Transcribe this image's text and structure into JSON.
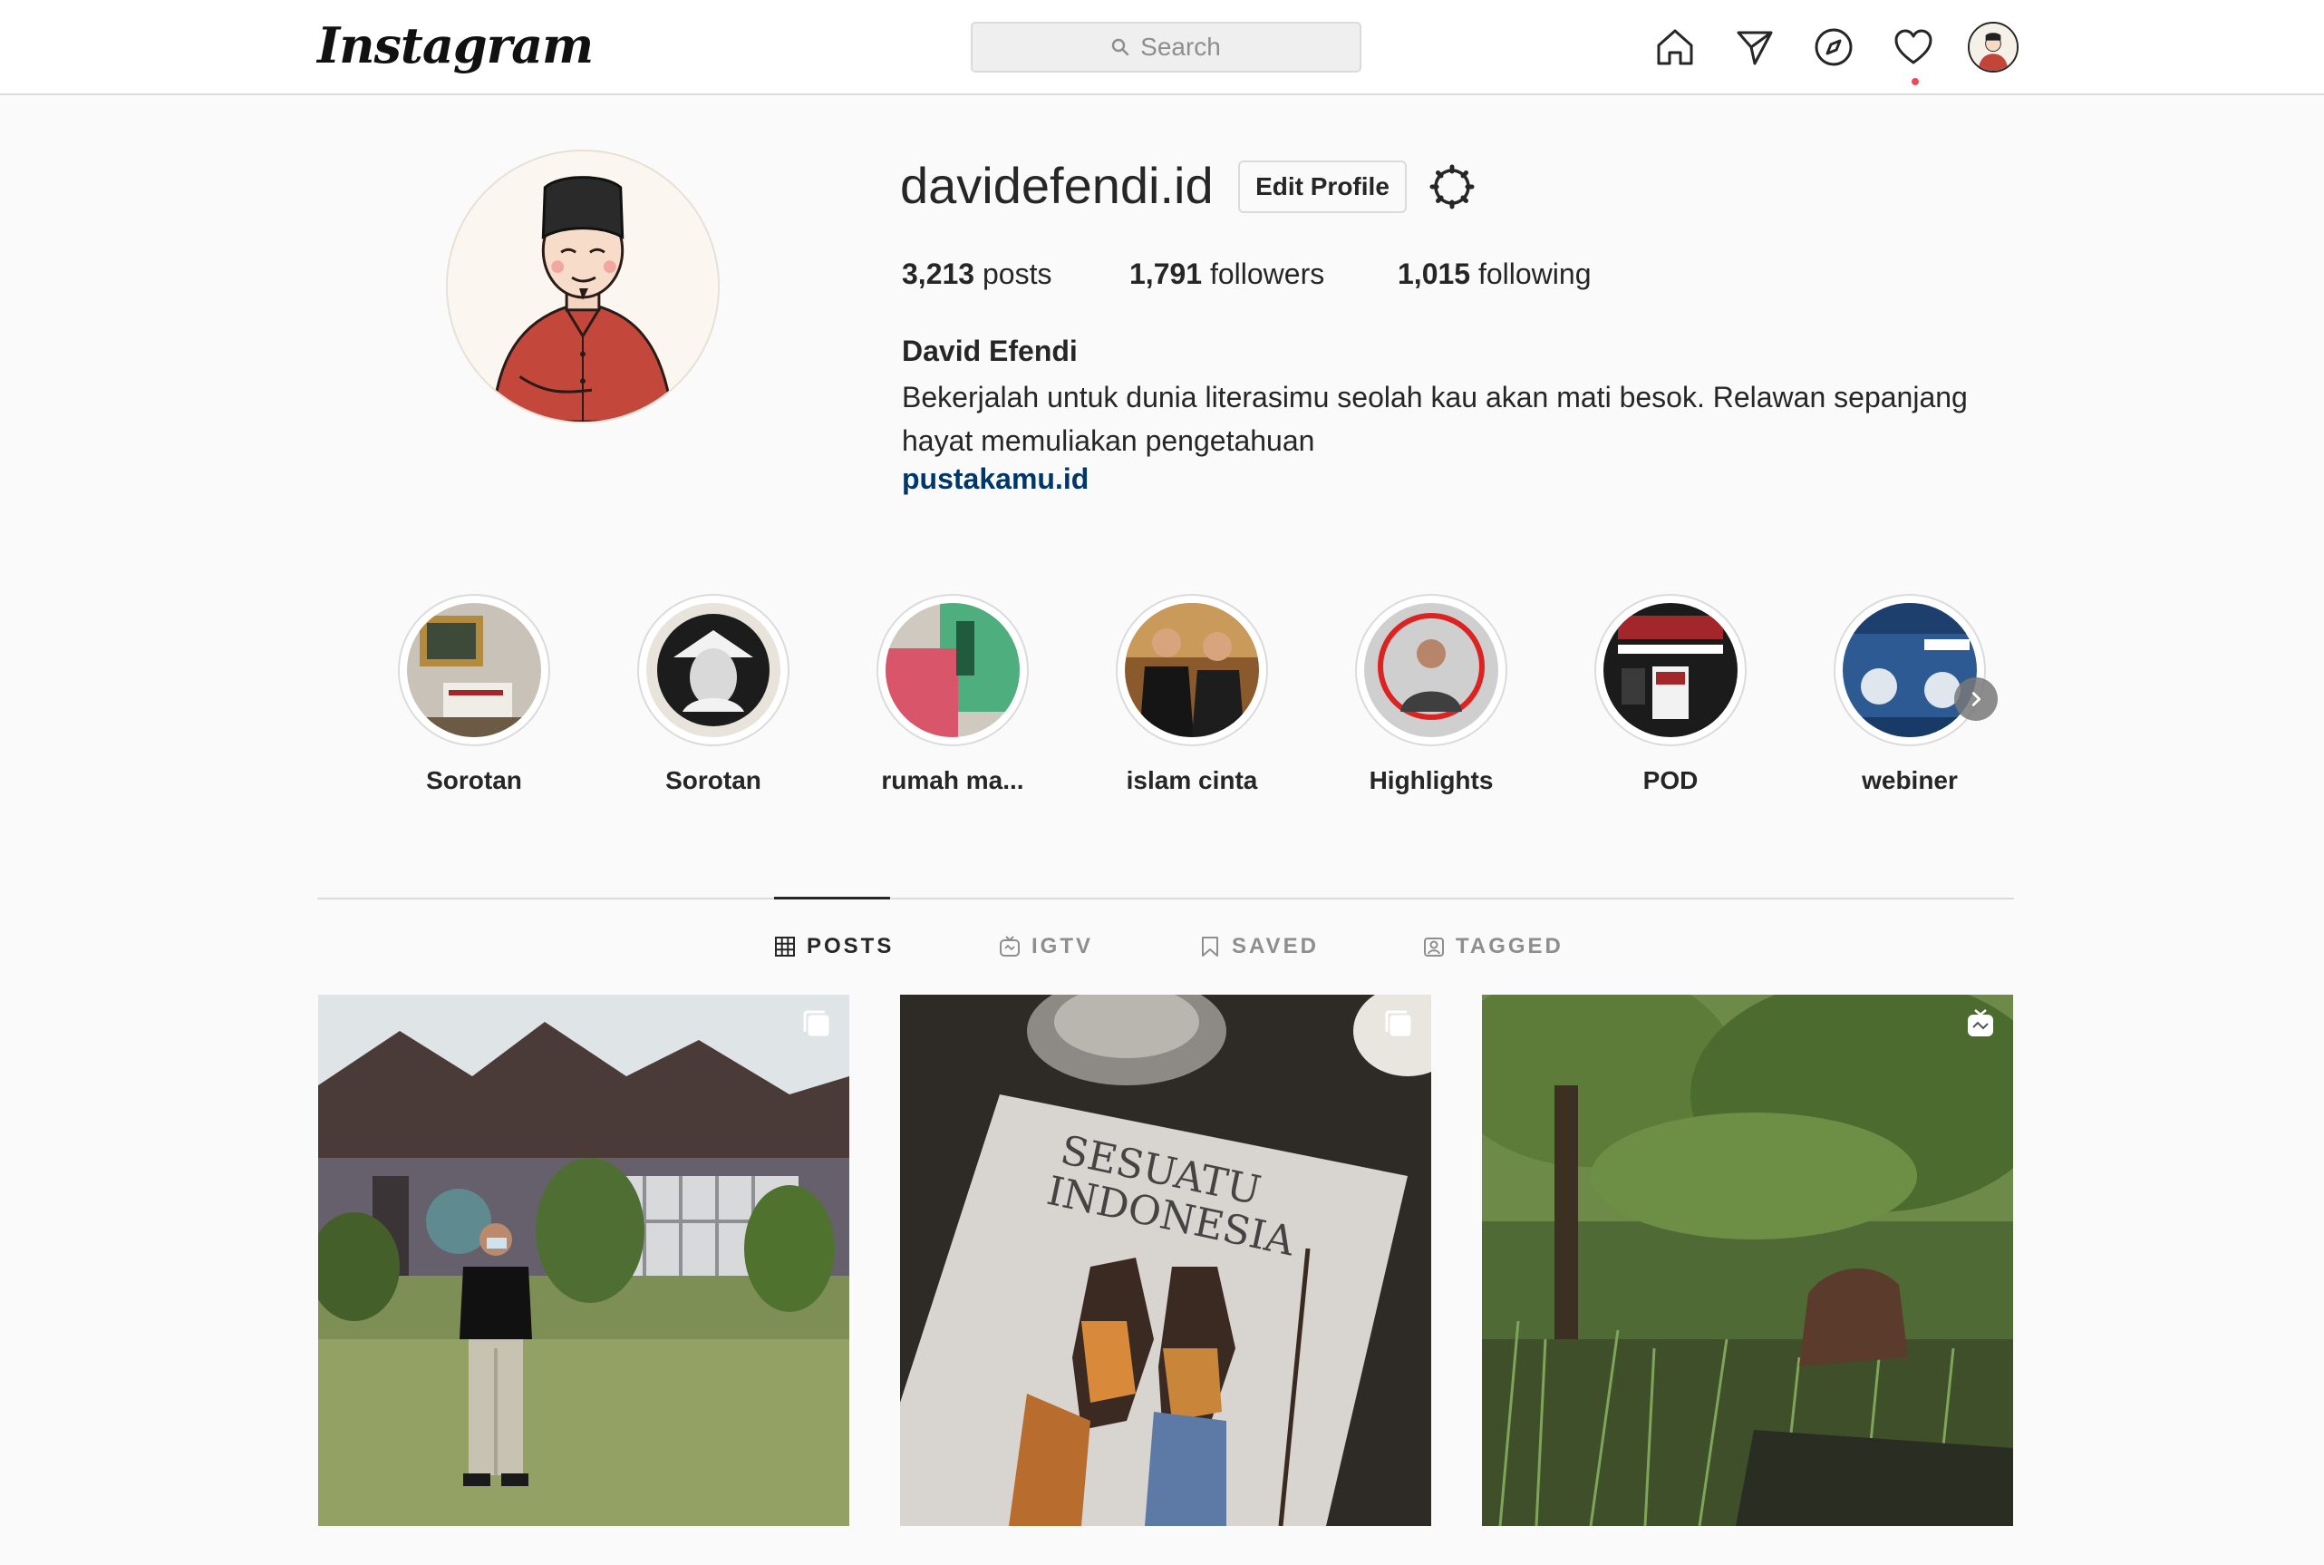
{
  "nav": {
    "logo": "Instagram",
    "search_placeholder": "Search",
    "icons": [
      "home-icon",
      "direct-icon",
      "explore-icon",
      "activity-heart-icon",
      "profile-avatar"
    ]
  },
  "profile": {
    "username": "davidefendi.id",
    "edit_label": "Edit Profile",
    "stats": {
      "posts_count": "3,213",
      "posts_label": "posts",
      "followers_count": "1,791",
      "followers_label": "followers",
      "following_count": "1,015",
      "following_label": "following"
    },
    "full_name": "David Efendi",
    "bio": "Bekerjalah untuk dunia literasimu seolah kau akan mati besok. Relawan sepanjang hayat memuliakan pengetahuan",
    "website": "pustakamu.id"
  },
  "highlights": [
    {
      "label": "Sorotan"
    },
    {
      "label": "Sorotan"
    },
    {
      "label": "rumah ma..."
    },
    {
      "label": "islam cinta"
    },
    {
      "label": "Highlights"
    },
    {
      "label": "POD"
    },
    {
      "label": "webiner"
    }
  ],
  "tabs": [
    {
      "label": "POSTS",
      "icon": "grid-icon",
      "active": true
    },
    {
      "label": "IGTV",
      "icon": "igtv-icon",
      "active": false
    },
    {
      "label": "SAVED",
      "icon": "bookmark-icon",
      "active": false
    },
    {
      "label": "TAGGED",
      "icon": "tagged-icon",
      "active": false
    }
  ],
  "posts": [
    {
      "badge": "multiple-icon"
    },
    {
      "badge": "multiple-icon"
    },
    {
      "badge": "igtv-icon"
    }
  ],
  "colors": {
    "background": "#fafafa",
    "border": "#dbdbdb",
    "text": "#262626",
    "muted": "#8e8e8e",
    "link": "#00376b",
    "notification": "#ed4956"
  }
}
